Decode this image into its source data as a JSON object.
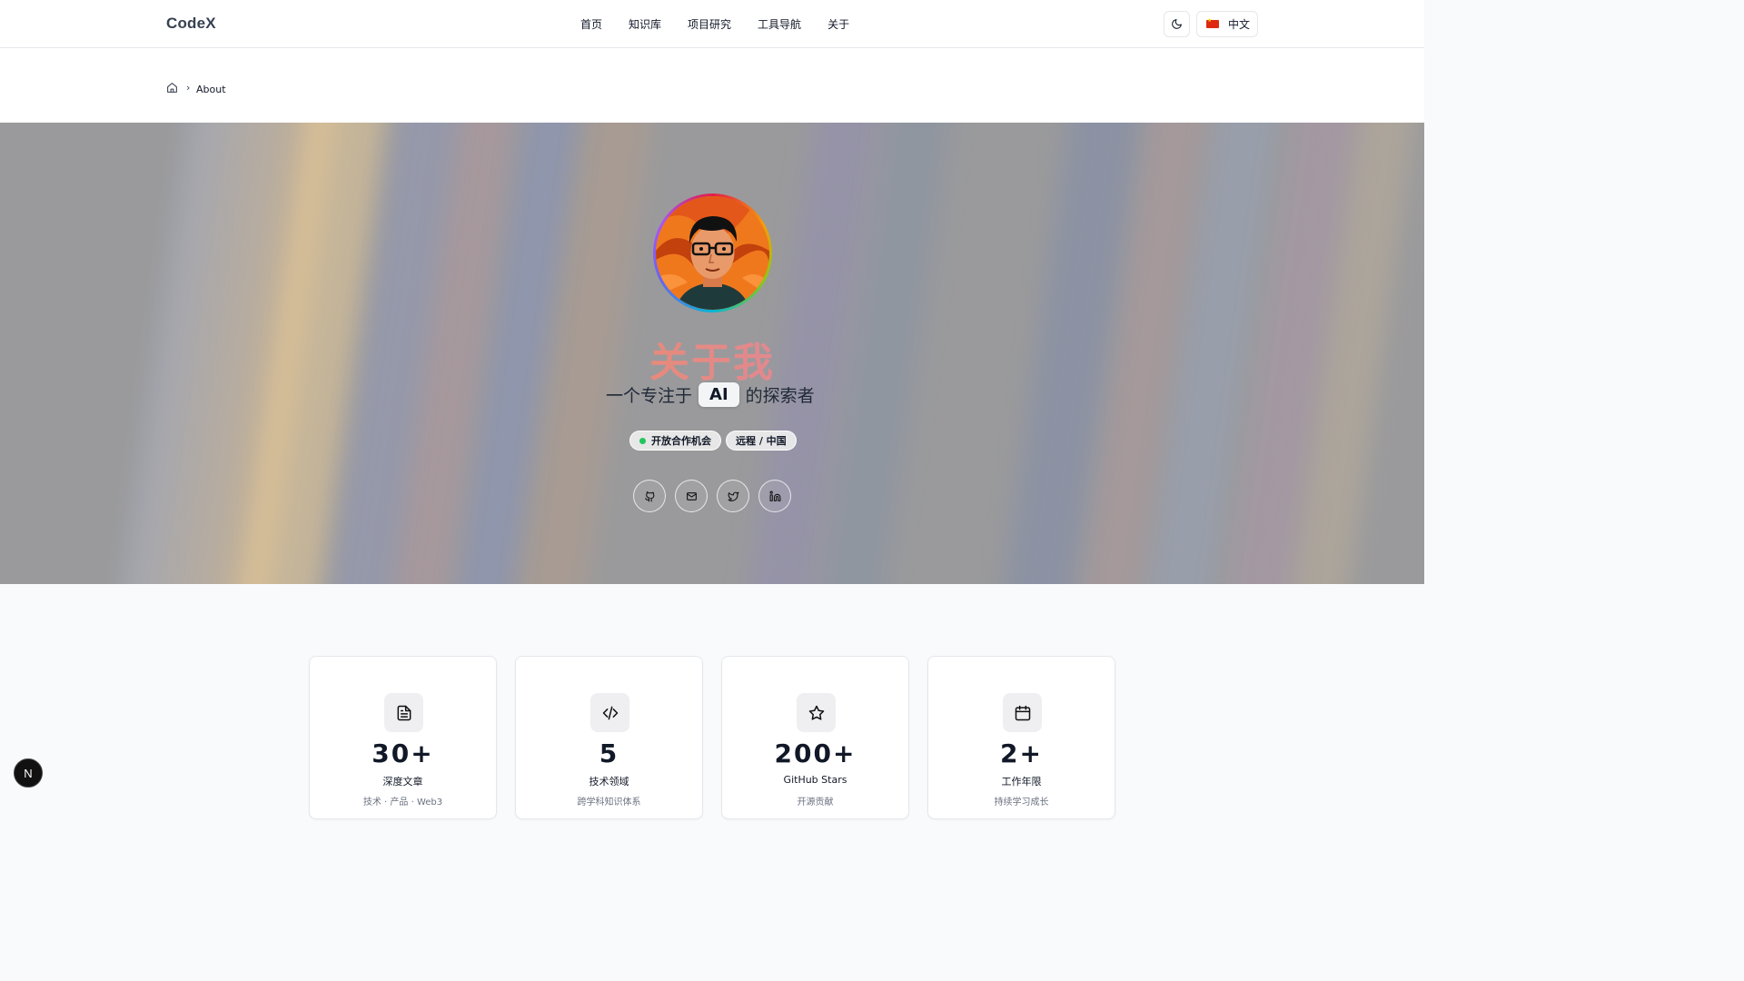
{
  "header": {
    "logo": "CodeX",
    "nav": [
      {
        "label": "首页"
      },
      {
        "label": "知识库"
      },
      {
        "label": "项目研究"
      },
      {
        "label": "工具导航"
      },
      {
        "label": "关于"
      }
    ],
    "theme_icon": "moon-icon",
    "language": {
      "flag": "china-flag-icon",
      "label": "中文"
    }
  },
  "breadcrumb": {
    "home_icon": "home-icon",
    "current": "About"
  },
  "hero": {
    "title": "关于我",
    "subtitle_prefix": "一个专注于",
    "subtitle_highlight": "AI",
    "subtitle_suffix": "的探索者",
    "badges": [
      {
        "label": "开放合作机会",
        "status_color": "#22c55e"
      },
      {
        "label": "远程 / 中国"
      }
    ],
    "social": [
      {
        "icon": "github-icon"
      },
      {
        "icon": "mail-icon"
      },
      {
        "icon": "twitter-icon"
      },
      {
        "icon": "linkedin-icon"
      }
    ]
  },
  "stats": [
    {
      "icon": "document-icon",
      "value": "30+",
      "label": "深度文章",
      "desc": "技术 · 产品 · Web3"
    },
    {
      "icon": "code-icon",
      "value": "5",
      "label": "技术领域",
      "desc": "跨学科知识体系"
    },
    {
      "icon": "star-icon",
      "value": "200+",
      "label": "GitHub Stars",
      "desc": "开源贡献"
    },
    {
      "icon": "calendar-icon",
      "value": "2+",
      "label": "工作年限",
      "desc": "持续学习成长"
    }
  ],
  "dev_badge": {
    "label": "N"
  }
}
